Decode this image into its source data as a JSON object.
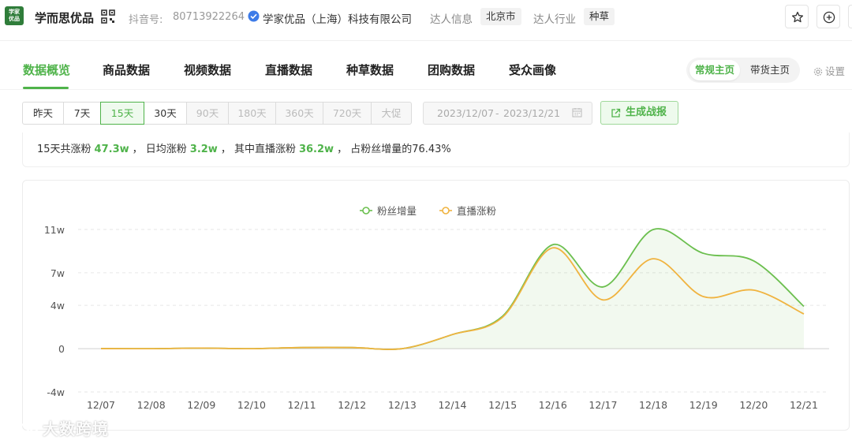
{
  "header": {
    "logo_text": "学家优品",
    "brand": "学而思优品",
    "douyin_label": "抖音号:",
    "douyin_id": "80713922264",
    "company": "学家优品（上海）科技有限公司",
    "talent_info_label": "达人信息",
    "city": "北京市",
    "industry_label": "达人行业",
    "industry": "种草",
    "icons": [
      "qr-code-icon",
      "verified-icon",
      "star-icon",
      "add-circle-icon"
    ]
  },
  "tabs": [
    {
      "label": "数据概览",
      "active": true
    },
    {
      "label": "商品数据"
    },
    {
      "label": "视频数据"
    },
    {
      "label": "直播数据"
    },
    {
      "label": "种草数据"
    },
    {
      "label": "团购数据"
    },
    {
      "label": "受众画像"
    }
  ],
  "homepage_toggle": {
    "options": [
      "常规主页",
      "带货主页"
    ],
    "selected": "常规主页"
  },
  "settings_label": "设置",
  "range_buttons": [
    {
      "label": "昨天",
      "state": "normal"
    },
    {
      "label": "7天",
      "state": "normal"
    },
    {
      "label": "15天",
      "state": "active"
    },
    {
      "label": "30天",
      "state": "normal"
    },
    {
      "label": "90天",
      "state": "disabled"
    },
    {
      "label": "180天",
      "state": "disabled"
    },
    {
      "label": "360天",
      "state": "disabled"
    },
    {
      "label": "720天",
      "state": "disabled"
    },
    {
      "label": "大促",
      "state": "disabled"
    }
  ],
  "date_range": {
    "start": "2023/12/07",
    "separator": "-",
    "end": "2023/12/21"
  },
  "report_button": "生成战报",
  "summary": {
    "p1": "15天共涨粉",
    "v1": "47.3w",
    "p2": "，  日均涨粉",
    "v2": "3.2w",
    "p3": "，  其中直播涨粉",
    "v3": "36.2w",
    "p4": "，  占粉丝增量的76.43%"
  },
  "colors": {
    "accent": "#4fb34a",
    "series_fans": "#6bbf4e",
    "series_live": "#f0b33f"
  },
  "watermark": "大数跨境",
  "chart_data": {
    "type": "line",
    "x": [
      "12/07",
      "12/08",
      "12/09",
      "12/10",
      "12/11",
      "12/12",
      "12/13",
      "12/14",
      "12/15",
      "12/16",
      "12/17",
      "12/18",
      "12/19",
      "12/20",
      "12/21"
    ],
    "yticks": [
      "11w",
      "7w",
      "4w",
      "0",
      "-4w"
    ],
    "ylim": [
      -4,
      11
    ],
    "grid": true,
    "legend_position": "top-center",
    "series": [
      {
        "name": "粉丝增量",
        "color": "#6bbf4e",
        "area": true,
        "values": [
          0,
          0,
          0.05,
          0,
          0.1,
          0.1,
          0,
          1.3,
          3.0,
          9.6,
          5.7,
          11.0,
          8.8,
          8.1,
          3.9
        ]
      },
      {
        "name": "直播涨粉",
        "color": "#f0b33f",
        "area": false,
        "values": [
          0,
          0,
          0.05,
          0,
          0.1,
          0.1,
          0,
          1.3,
          2.9,
          9.3,
          4.5,
          8.3,
          4.8,
          5.4,
          3.2
        ]
      }
    ]
  }
}
